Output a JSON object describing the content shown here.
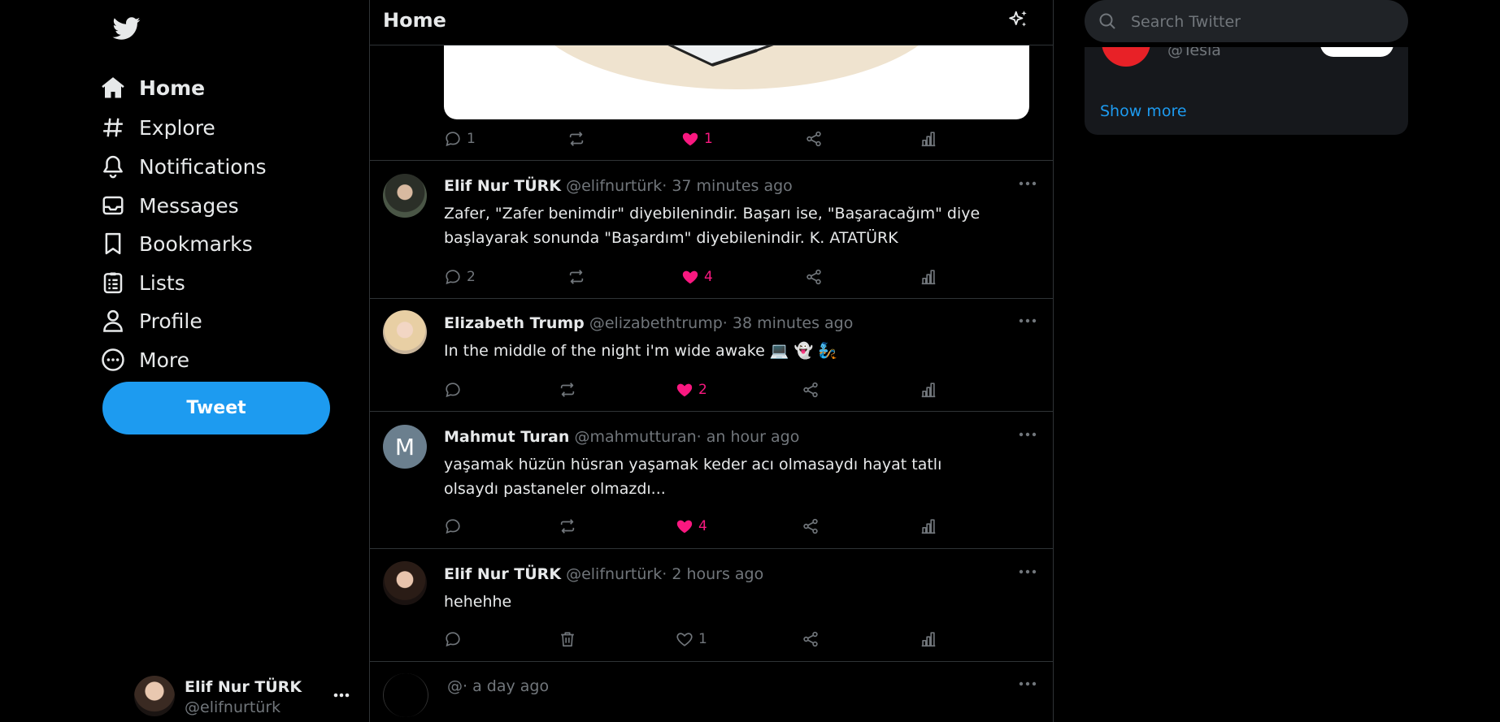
{
  "sidebar": {
    "nav": [
      {
        "label": "Home",
        "icon": "home-icon",
        "active": true
      },
      {
        "label": "Explore",
        "icon": "hashtag-icon"
      },
      {
        "label": "Notifications",
        "icon": "bell-icon"
      },
      {
        "label": "Messages",
        "icon": "envelope-icon"
      },
      {
        "label": "Bookmarks",
        "icon": "bookmark-icon"
      },
      {
        "label": "Lists",
        "icon": "list-icon"
      },
      {
        "label": "Profile",
        "icon": "person-icon"
      },
      {
        "label": "More",
        "icon": "more-circle-icon"
      }
    ],
    "tweet_button": "Tweet",
    "account": {
      "name": "Elif Nur TÜRK",
      "handle": "@elifnurtürk"
    }
  },
  "header": {
    "title": "Home"
  },
  "first_tweet_actions": {
    "replies": "1",
    "likes": "1"
  },
  "tweets": [
    {
      "name": "Elif Nur TÜRK",
      "handle": "@elifnurtürk",
      "time": "· 37 minutes ago",
      "text": "Zafer, \"Zafer benimdir\" diyebilenindir. Başarı ise, \"Başaracağım\" diye başlayarak sonunda \"Başardım\" diyebilenindir. K. ATATÜRK",
      "replies": "2",
      "likes": "4",
      "liked": true
    },
    {
      "name": "Elizabeth Trump",
      "handle": "@elizabethtrump",
      "time": "· 38 minutes ago",
      "text": "In the middle of the night i'm wide awake 💻 👻 🧞",
      "replies": "",
      "likes": "2",
      "liked": true
    },
    {
      "name": "Mahmut Turan",
      "handle": "@mahmutturan",
      "time": "· an hour ago",
      "text": "yaşamak hüzün hüsran yaşamak keder acı olmasaydı hayat tatlı olsaydı pastaneler olmazdı...",
      "replies": "",
      "likes": "4",
      "liked": true,
      "avatar_letter": "M"
    },
    {
      "name": "Elif Nur TÜRK",
      "handle": "@elifnurtürk",
      "time": "· 2 hours ago",
      "text": "hehehhe",
      "replies": "",
      "likes": "1",
      "liked": false
    },
    {
      "name": "",
      "handle": "@",
      "time": "· a day ago",
      "text": "",
      "replies": "",
      "likes": "",
      "liked": false
    }
  ],
  "search": {
    "placeholder": "Search Twitter"
  },
  "who_to_follow": {
    "handle": "@Tesla",
    "show_more": "Show more"
  },
  "colors": {
    "accent": "#1d9bf0",
    "like": "#f91880",
    "muted": "#71767b",
    "text": "#e7e9ea",
    "border": "#2f3336"
  }
}
